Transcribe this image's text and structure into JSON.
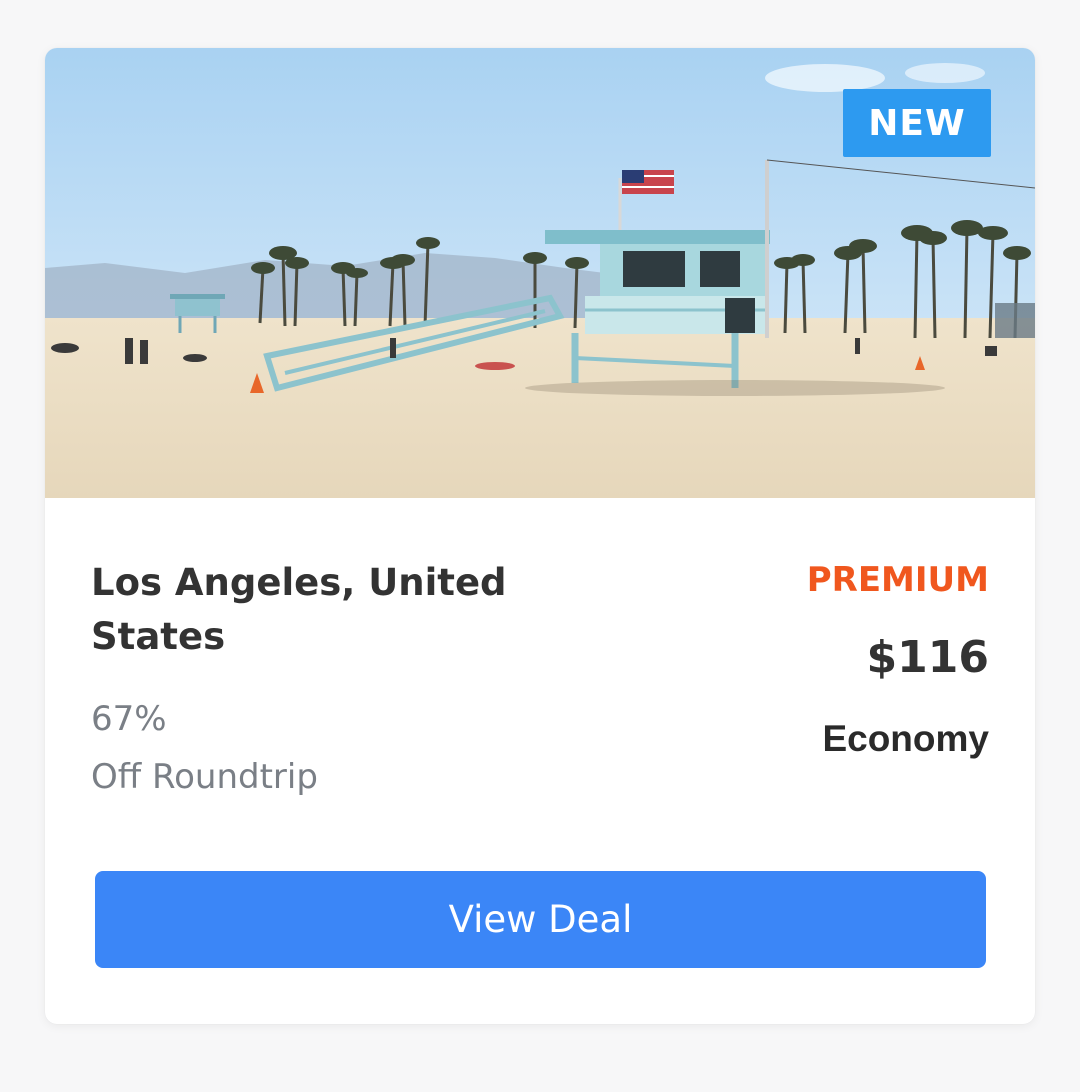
{
  "deal": {
    "badge": "NEW",
    "destination": "Los Angeles, United States",
    "discount_percent": "67%",
    "discount_text": "Off Roundtrip",
    "tier": "PREMIUM",
    "price": "$116",
    "cabin_class": "Economy",
    "cta_label": "View Deal"
  },
  "colors": {
    "badge_bg": "#2d9af0",
    "tier_text": "#f0571e",
    "cta_bg": "#3b86f7",
    "title_text": "#333333",
    "muted_text": "#7a7f86"
  }
}
